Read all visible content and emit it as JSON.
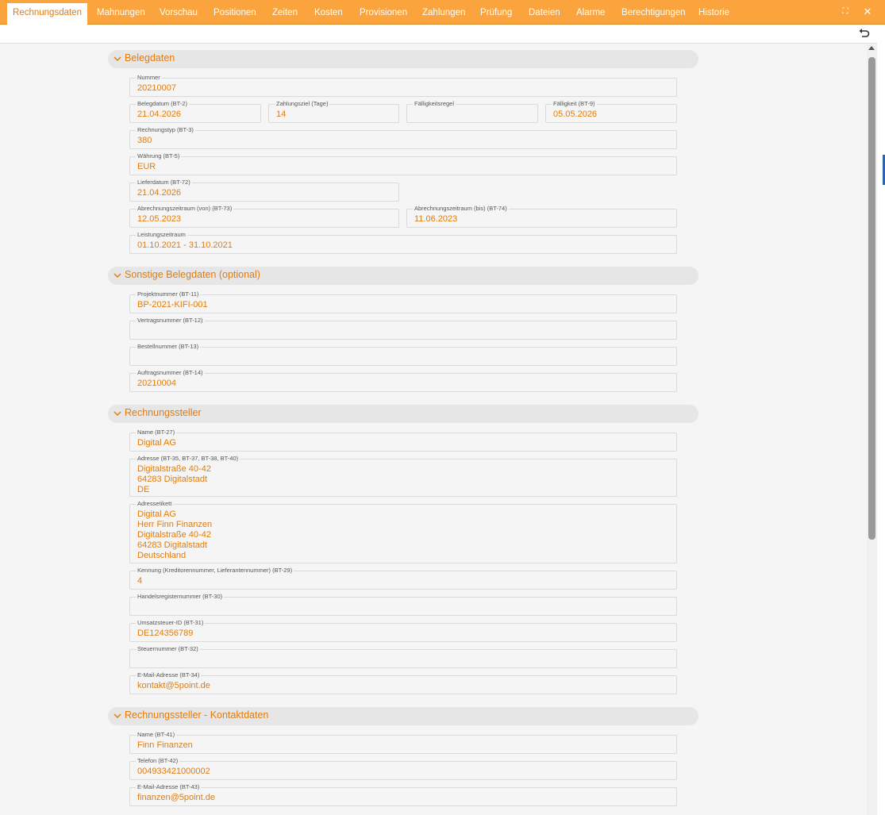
{
  "tabs": [
    {
      "label": "Rechnungsdaten"
    },
    {
      "label": "Mahnungen"
    },
    {
      "label": "Vorschau"
    },
    {
      "label": "Positionen"
    },
    {
      "label": "Zeiten"
    },
    {
      "label": "Kosten"
    },
    {
      "label": "Provisionen"
    },
    {
      "label": "Zahlungen"
    },
    {
      "label": "Prüfung"
    },
    {
      "label": "Dateien"
    },
    {
      "label": "Alarme"
    },
    {
      "label": "Berechtigungen"
    },
    {
      "label": "Historie"
    }
  ],
  "window": {
    "maximize_icon": "⛶",
    "close_icon": "✕"
  },
  "sections": {
    "belegdaten": {
      "title": "Belegdaten",
      "nummer": {
        "label": "Nummer",
        "value": "20210007"
      },
      "belegdatum": {
        "label": "Belegdatum (BT-2)",
        "value": "21.04.2026"
      },
      "zahlungsziel": {
        "label": "Zahlungsziel (Tage)",
        "value": "14"
      },
      "faelligkeitsregel": {
        "label": "Fälligkeitsregel",
        "value": ""
      },
      "faelligkeit": {
        "label": "Fälligkeit (BT-9)",
        "value": "05.05.2026"
      },
      "rechnungstyp": {
        "label": "Rechnungstyp (BT-3)",
        "value": "380"
      },
      "waehrung": {
        "label": "Währung (BT-5)",
        "value": "EUR"
      },
      "lieferdatum": {
        "label": "Lieferdatum (BT-72)",
        "value": "21.04.2026"
      },
      "abrechnung_von": {
        "label": "Abrechnungszeitraum (von) (BT-73)",
        "value": "12.05.2023"
      },
      "abrechnung_bis": {
        "label": "Abrechnungszeitraum (bis) (BT-74)",
        "value": "11.06.2023"
      },
      "leistungszeitraum": {
        "label": "Leistungszeitraum",
        "value": "01.10.2021 - 31.10.2021"
      }
    },
    "sonstige": {
      "title": "Sonstige Belegdaten (optional)",
      "projektnummer": {
        "label": "Projektnummer (BT-11)",
        "value": "BP-2021-KIFI-001"
      },
      "vertragsnummer": {
        "label": "Vertragsnummer (BT-12)",
        "value": ""
      },
      "bestellnummer": {
        "label": "Bestellnummer (BT-13)",
        "value": ""
      },
      "auftragsnummer": {
        "label": "Auftragsnummer (BT-14)",
        "value": "20210004"
      }
    },
    "steller": {
      "title": "Rechnungssteller",
      "name": {
        "label": "Name (BT-27)",
        "value": "Digital AG"
      },
      "adresse": {
        "label": "Adresse (BT-35, BT-37, BT-38, BT-40)",
        "value": "Digitalstraße 40-42\n64283 Digitalstadt\nDE"
      },
      "adressetikett": {
        "label": "Adressetikett",
        "value": "Digital AG\nHerr Finn Finanzen\nDigitalstraße 40-42\n64283 Digitalstadt\nDeutschland"
      },
      "kennung": {
        "label": "Kennung (Kreditorennummer, Lieferantennummer) (BT-29)",
        "value": "4"
      },
      "handelsregister": {
        "label": "Handelsregisternummer (BT-30)",
        "value": ""
      },
      "ustid": {
        "label": "Umsatzsteuer-ID (BT-31)",
        "value": "DE124356789"
      },
      "steuernummer": {
        "label": "Steuernummer (BT-32)",
        "value": ""
      },
      "email": {
        "label": "E-Mail-Adresse (BT-34)",
        "value": "kontakt@5point.de"
      }
    },
    "kontakt": {
      "title": "Rechnungssteller - Kontaktdaten",
      "name": {
        "label": "Name (BT-41)",
        "value": "Finn Finanzen"
      },
      "telefon": {
        "label": "Telefon (BT-42)",
        "value": "004933421000002"
      },
      "email": {
        "label": "E-Mail-Adresse (BT-43)",
        "value": "finanzen@5point.de"
      }
    }
  },
  "colors": {
    "accent": "#fba43d",
    "value_text": "#e07c10"
  }
}
